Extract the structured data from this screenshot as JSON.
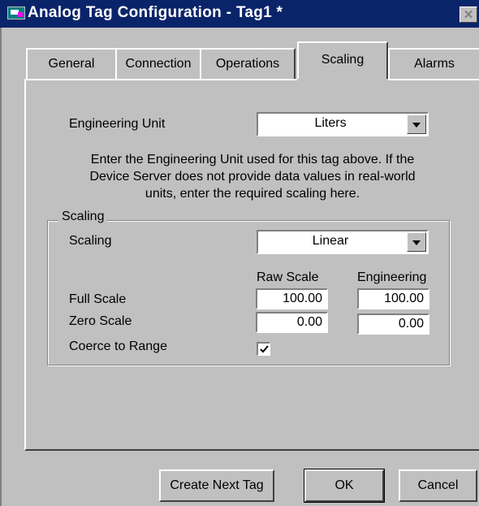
{
  "window": {
    "title": "Analog Tag Configuration - Tag1 *",
    "app_icon": "tag-config-app-icon",
    "close_glyph": "✕"
  },
  "tabs": [
    {
      "label": "General",
      "active": false
    },
    {
      "label": "Connection",
      "active": false
    },
    {
      "label": "Operations",
      "active": false
    },
    {
      "label": "Scaling",
      "active": true
    },
    {
      "label": "Alarms",
      "active": false
    }
  ],
  "engineering_unit": {
    "label": "Engineering Unit",
    "value": "Liters"
  },
  "help_text": {
    "line1": "Enter the Engineering Unit used for this tag above.  If the",
    "line2": "Device Server does not provide data values in real-world",
    "line3": "units, enter the required scaling here."
  },
  "scaling_group": {
    "title": "Scaling",
    "scaling_label": "Scaling",
    "scaling_value": "Linear",
    "raw_scale_header": "Raw Scale",
    "engineering_header": "Engineering",
    "full_scale_label": "Full Scale",
    "full_scale_raw": "100.00",
    "full_scale_eng": "100.00",
    "zero_scale_label": "Zero Scale",
    "zero_scale_raw": "0.00",
    "zero_scale_eng": "0.00",
    "coerce_label": "Coerce to Range",
    "coerce_checked": true
  },
  "buttons": {
    "create_next": "Create Next Tag",
    "ok": "OK",
    "cancel": "Cancel"
  },
  "colors": {
    "titlebar": "#0a246a",
    "face": "#c0c0c0"
  }
}
